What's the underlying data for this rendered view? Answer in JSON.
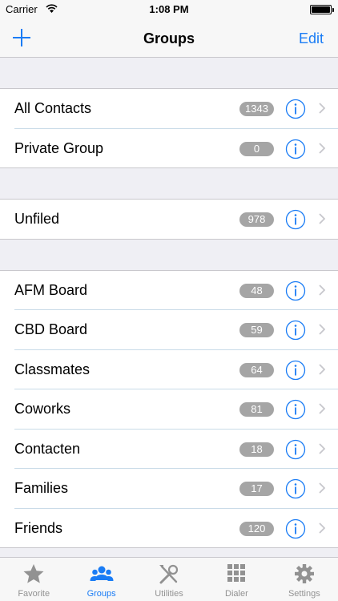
{
  "status_bar": {
    "carrier": "Carrier",
    "time": "1:08 PM"
  },
  "nav": {
    "title": "Groups",
    "edit_label": "Edit"
  },
  "sections": [
    {
      "rows": [
        {
          "label": "All Contacts",
          "count": "1343"
        },
        {
          "label": "Private Group",
          "count": "0"
        }
      ]
    },
    {
      "rows": [
        {
          "label": "Unfiled",
          "count": "978"
        }
      ]
    },
    {
      "rows": [
        {
          "label": "AFM Board",
          "count": "48"
        },
        {
          "label": "CBD Board",
          "count": "59"
        },
        {
          "label": "Classmates",
          "count": "64"
        },
        {
          "label": "Coworks",
          "count": "81"
        },
        {
          "label": "Contacten",
          "count": "18"
        },
        {
          "label": "Families",
          "count": "17"
        },
        {
          "label": "Friends",
          "count": "120"
        }
      ]
    }
  ],
  "tabs": [
    {
      "label": "Favorite",
      "icon": "star-icon",
      "active": false
    },
    {
      "label": "Groups",
      "icon": "group-icon",
      "active": true
    },
    {
      "label": "Utilities",
      "icon": "tools-icon",
      "active": false
    },
    {
      "label": "Dialer",
      "icon": "keypad-icon",
      "active": false
    },
    {
      "label": "Settings",
      "icon": "gear-icon",
      "active": false
    }
  ],
  "colors": {
    "accent": "#1a7cf5",
    "badge": "#a5a5a5",
    "inactive_tab": "#929292",
    "background": "#efeff4"
  }
}
